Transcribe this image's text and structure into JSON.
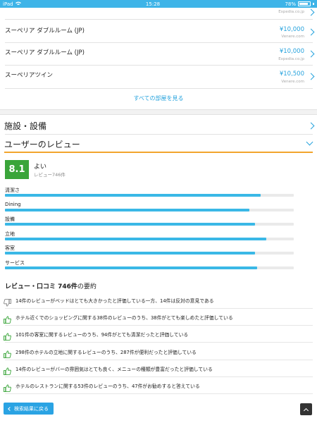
{
  "status_bar": {
    "device": "iPad",
    "time": "15:28",
    "battery": "78%"
  },
  "rooms": [
    {
      "name": "",
      "price": "",
      "source": "Expedia.co.jp"
    },
    {
      "name": "スーペリア ダブルルーム (JP)",
      "price": "¥10,000",
      "source": "Venere.com"
    },
    {
      "name": "スーペリア ダブルルーム (JP)",
      "price": "¥10,000",
      "source": "Expedia.co.jp"
    },
    {
      "name": "スーペリアツイン",
      "price": "¥10,500",
      "source": "Venere.com"
    }
  ],
  "see_all_rooms": "すべての部屋を見る",
  "facilities": {
    "title": "施設・設備"
  },
  "reviews": {
    "title": "ユーザーのレビュー",
    "score": "8.1",
    "score_word": "よい",
    "review_count": "レビュー746件",
    "categories": [
      {
        "label": "清潔さ",
        "value": 0.885
      },
      {
        "label": "Dining",
        "value": 0.847
      },
      {
        "label": "設備",
        "value": 0.866
      },
      {
        "label": "立地",
        "value": 0.904
      },
      {
        "label": "客室",
        "value": 0.866
      },
      {
        "label": "サービス",
        "value": 0.873
      }
    ]
  },
  "summary": {
    "title_bold": "レビュー・口コミ 746件",
    "title_rest": "の要約",
    "items": [
      {
        "icon": "thumbs-down-icon",
        "color": "#888888",
        "text": "14件のレビューがベッドはとても大きかったと評価している一方、14件は反対の意見である"
      },
      {
        "icon": "thumbs-up-icon",
        "color": "#3aa53a",
        "text": "ホテル近くでのショッピングに関する38件のレビューのうち、38件がとても楽しめたと評価している"
      },
      {
        "icon": "thumbs-up-icon",
        "color": "#3aa53a",
        "text": "101件の客室に関するレビューのうち、94件がとても清潔だったと評価している"
      },
      {
        "icon": "thumbs-up-icon",
        "color": "#3aa53a",
        "text": "298件のホテルの立地に関するレビューのうち、287件が便利だったと評価している"
      },
      {
        "icon": "thumbs-up-icon",
        "color": "#3aa53a",
        "text": "14件のレビューがバーの雰囲気はとても良く、メニューの種類が豊富だったと評価している"
      },
      {
        "icon": "thumbs-up-icon",
        "color": "#3aa53a",
        "text": "ホテルのレストランに関する53件のレビューのうち、47件がお勧めすると答えている"
      }
    ]
  },
  "footer": {
    "back_label": "検索結果に戻る"
  },
  "colors": {
    "accent": "#27a3dd",
    "score_green": "#3aa53a",
    "highlight_orange": "#f2a52d",
    "bar_blue": "#3ab8e6"
  }
}
